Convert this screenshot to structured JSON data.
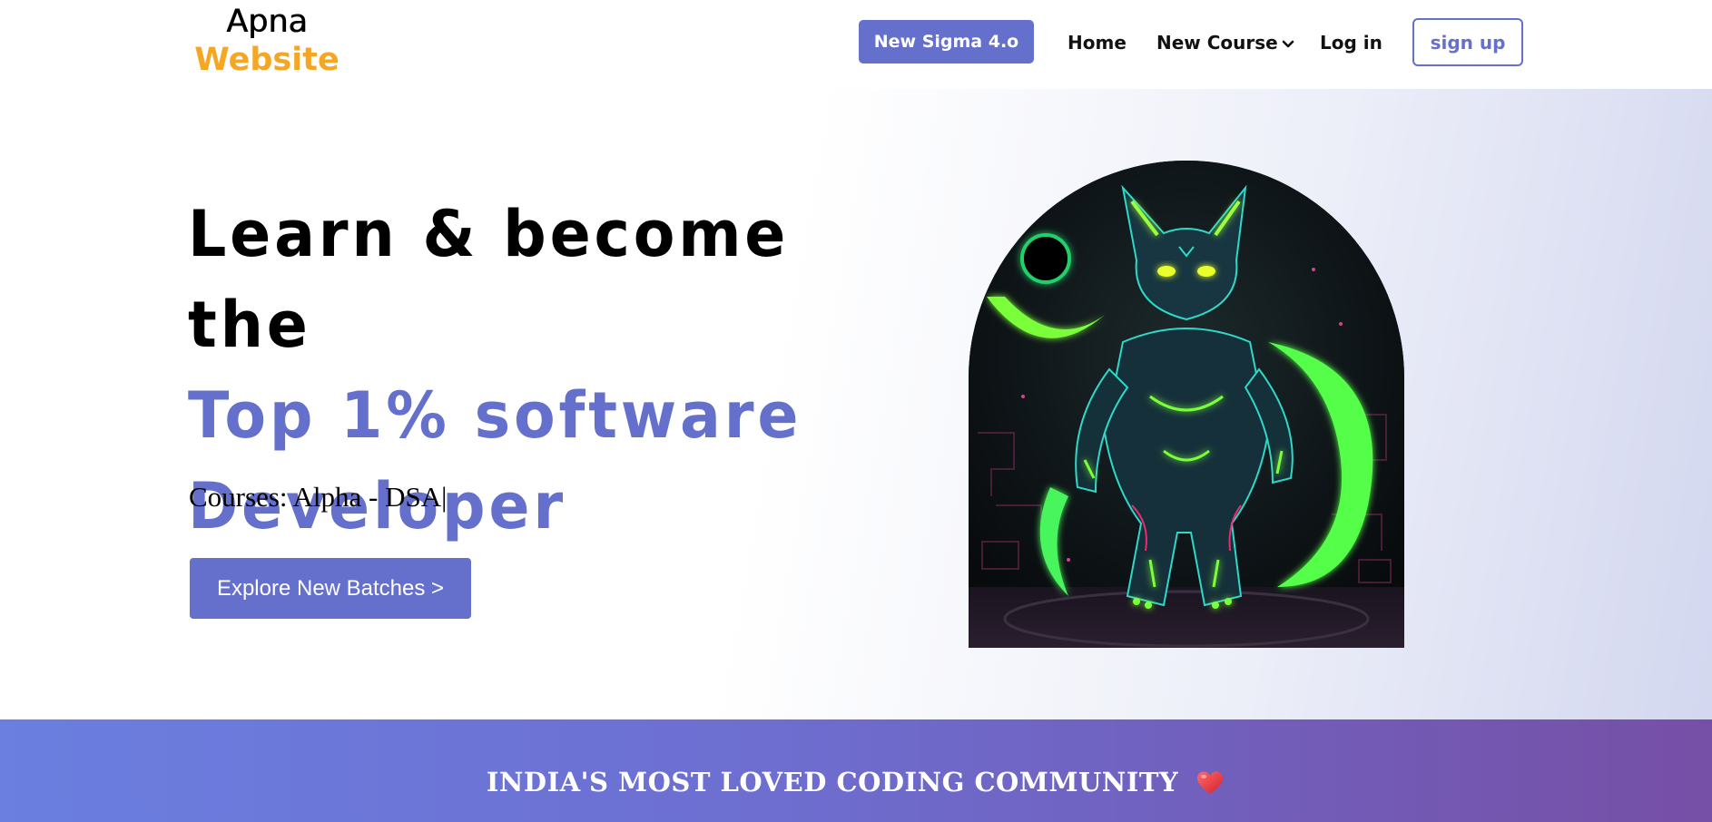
{
  "brand": {
    "line1": "Apna",
    "line2": "Website",
    "accent_color": "#f5a623"
  },
  "nav": {
    "promo_button": "New Sigma 4.o",
    "home": "Home",
    "new_course": "New Course",
    "login": "Log in",
    "signup": "sign up",
    "primary_color": "#6470cc"
  },
  "hero": {
    "title_line1": "Learn & become the",
    "title_line2": "Top 1% software",
    "title_line3": "Developer",
    "courses_text": "Courses: Alpha - DSA|",
    "cta_button": "Explore New Batches >",
    "image_alt": "neon armored cat character illustration"
  },
  "community": {
    "headline": "INDIA'S MOST LOVED CODING COMMUNITY",
    "icon": "heart-icon"
  }
}
